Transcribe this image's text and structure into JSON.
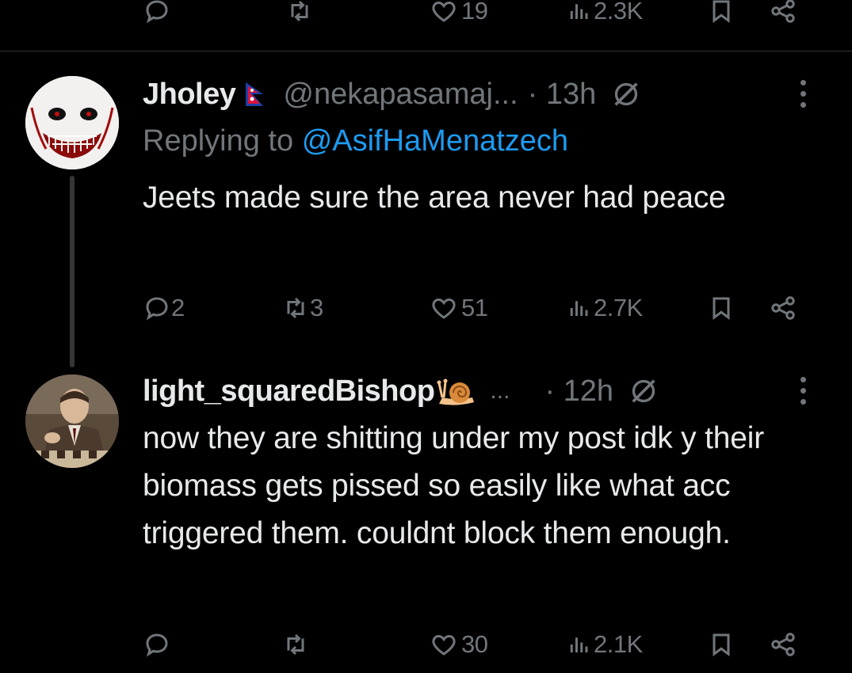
{
  "top_bar": {
    "like_count": "19",
    "view_count": "2.3K"
  },
  "tweets": [
    {
      "display_name": "Jholey",
      "flag": "Nepal flag",
      "handle": "@nekapasamaj...",
      "time": "· 13h",
      "replying_label": "Replying to",
      "replying_to": "@AsifHaMenatzech",
      "text": "Jeets made sure the area never had peace",
      "reply_count": "2",
      "retweet_count": "3",
      "like_count": "51",
      "view_count": "2.7K"
    },
    {
      "display_name": "light_squaredBishop",
      "badge": "snail-emoji",
      "ellipsis": "...",
      "time": "· 12h",
      "text": "now they are shitting under my post idk y their biomass gets pissed so easily like what acc triggered them. couldnt block them enough.",
      "reply_count": "",
      "retweet_count": "",
      "like_count": "30",
      "view_count": "2.1K"
    }
  ],
  "colors": {
    "background": "#000000",
    "text": "#e7e9ea",
    "muted": "#71767b",
    "link": "#1d9bf0",
    "divider": "#2f3336"
  }
}
